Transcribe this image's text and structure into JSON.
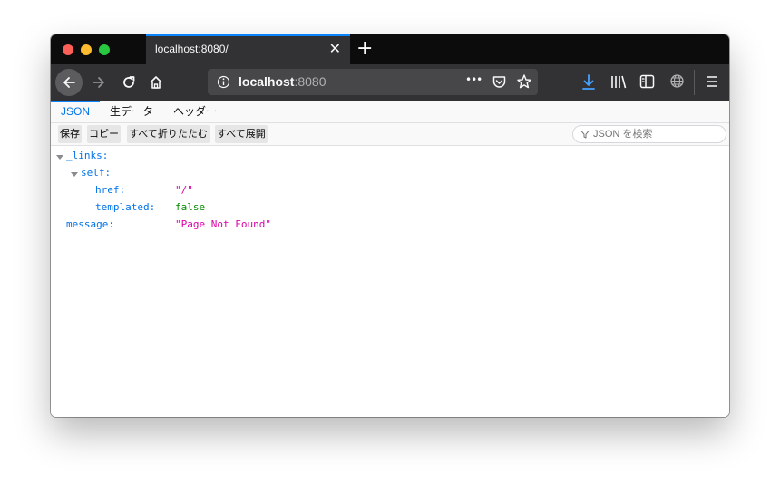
{
  "tab": {
    "title": "localhost:8080/",
    "close_glyph": "✕"
  },
  "new_tab_glyph": "+",
  "urlbar": {
    "host": "localhost",
    "port": ":8080",
    "page_actions": "•••"
  },
  "viewer_tabs": [
    "JSON",
    "生データ",
    "ヘッダー"
  ],
  "toolbar": {
    "buttons": [
      "保存",
      "コピー",
      "すべて折りたたむ",
      "すべて展開"
    ],
    "filter_placeholder": "JSON を検索"
  },
  "json_tree": {
    "links_key": "_links:",
    "self_key": "self:",
    "href_key": "href:",
    "href_value": "\"/\"",
    "templated_key": "templated:",
    "templated_value": "false",
    "message_key": "message:",
    "message_value": "\"Page Not Found\""
  },
  "colors": {
    "accent": "#0a84ff",
    "key": "#0074e8",
    "string": "#dd00a9",
    "boolean": "#058b00",
    "chrome_dark": "#323234"
  },
  "icons": [
    "back-arrow-icon",
    "forward-arrow-icon",
    "reload-icon",
    "home-icon",
    "info-icon",
    "pocket-icon",
    "star-icon",
    "download-icon",
    "library-icon",
    "sidebar-icon",
    "globe-icon",
    "hamburger-menu-icon",
    "filter-icon"
  ]
}
